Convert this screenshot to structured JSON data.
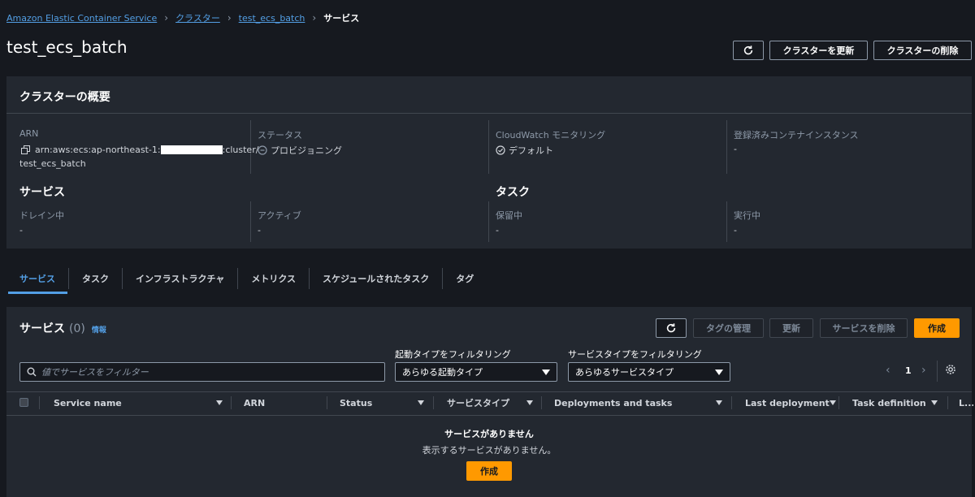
{
  "breadcrumb": {
    "items": [
      "Amazon Elastic Container Service",
      "クラスター",
      "test_ecs_batch"
    ],
    "current": "サービス"
  },
  "page": {
    "title": "test_ecs_batch"
  },
  "header_actions": {
    "update_label": "クラスターを更新",
    "delete_label": "クラスターの削除"
  },
  "overview": {
    "title": "クラスターの概要",
    "arn_label": "ARN",
    "arn_line1_prefix": "arn:aws:ecs:ap-northeast-1:",
    "arn_line1_suffix": ":cluster/",
    "arn_line2": "test_ecs_batch",
    "status_label": "ステータス",
    "status_value": "プロビジョニング",
    "cloudwatch_label": "CloudWatch モニタリング",
    "cloudwatch_value": "デフォルト",
    "instances_label": "登録済みコンテナインスタンス",
    "instances_value": "-",
    "services_heading": "サービス",
    "draining_label": "ドレイン中",
    "draining_value": "-",
    "active_label": "アクティブ",
    "active_value": "-",
    "tasks_heading": "タスク",
    "pending_label": "保留中",
    "pending_value": "-",
    "running_label": "実行中",
    "running_value": "-"
  },
  "tabs": [
    "サービス",
    "タスク",
    "インフラストラクチャ",
    "メトリクス",
    "スケジュールされたタスク",
    "タグ"
  ],
  "services": {
    "title": "サービス",
    "count": "(0)",
    "info_link": "情報",
    "manage_tags_label": "タグの管理",
    "update_label": "更新",
    "delete_label": "サービスを削除",
    "create_label": "作成",
    "search_placeholder": "値でサービスをフィルター",
    "launch_filter_label": "起動タイプをフィルタリング",
    "launch_filter_value": "あらゆる起動タイプ",
    "service_type_filter_label": "サービスタイプをフィルタリング",
    "service_type_filter_value": "あらゆるサービスタイプ",
    "page_number": "1",
    "columns": [
      "Service name",
      "ARN",
      "Status",
      "サービスタイプ",
      "Deployments and tasks",
      "Last deployment",
      "Task definition",
      "L..."
    ],
    "empty_title": "サービスがありません",
    "empty_message": "表示するサービスがありません。",
    "empty_create_label": "作成"
  },
  "colors": {
    "accent": "#539fe5",
    "primary": "#ff9900",
    "background": "#16191f",
    "panel": "#232830"
  }
}
